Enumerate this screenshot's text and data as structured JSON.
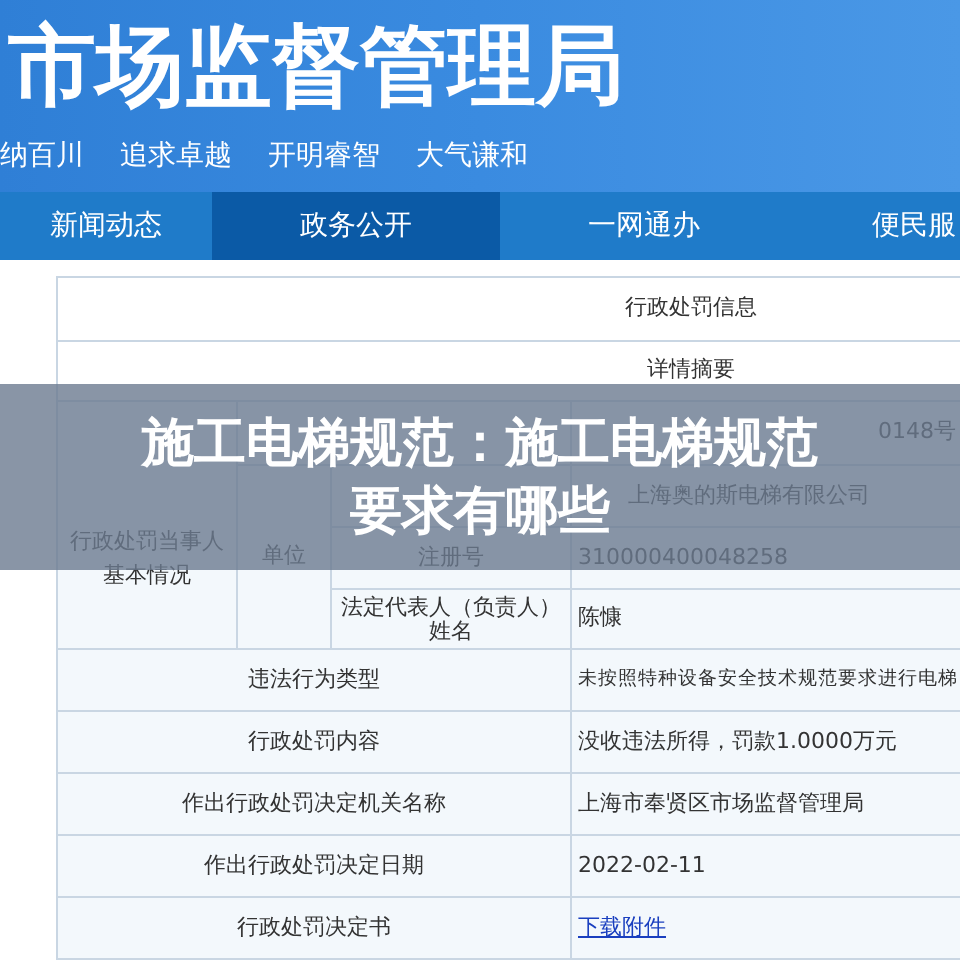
{
  "header": {
    "title": "市场监督管理局",
    "slogans": [
      "纳百川",
      "追求卓越",
      "开明睿智",
      "大气谦和"
    ]
  },
  "nav": [
    {
      "label": "新闻动态",
      "selected": false
    },
    {
      "label": "政务公开",
      "selected": true
    },
    {
      "label": "一网通办",
      "selected": false
    },
    {
      "label": "便民服",
      "selected": false
    }
  ],
  "table": {
    "heading": "行政处罚信息",
    "subheading": "详情摘要",
    "party_label": "行政处罚当事人基本情况",
    "unit_label": "单位",
    "party_rows": [
      {
        "label": "",
        "value": "0148号"
      },
      {
        "label": "",
        "value": "上海奥的斯电梯有限公司"
      },
      {
        "label": "注册号",
        "value": "310000400048258"
      },
      {
        "label": "法定代表人（负责人）姓名",
        "value": "陈慷"
      }
    ],
    "rows": [
      {
        "label": "违法行为类型",
        "value": "未按照特种设备安全技术规范要求进行电梯",
        "kind": "text"
      },
      {
        "label": "行政处罚内容",
        "value": "没收违法所得，罚款1.0000万元",
        "kind": "text"
      },
      {
        "label": "作出行政处罚决定机关名称",
        "value": "上海市奉贤区市场监督管理局",
        "kind": "text"
      },
      {
        "label": "作出行政处罚决定日期",
        "value": "2022-02-11",
        "kind": "text"
      },
      {
        "label": "行政处罚决定书",
        "value": "下载附件",
        "kind": "link"
      }
    ]
  },
  "overlay": {
    "title_lines": [
      "施工电梯规范：施工电梯规范",
      "要求有哪些"
    ]
  }
}
